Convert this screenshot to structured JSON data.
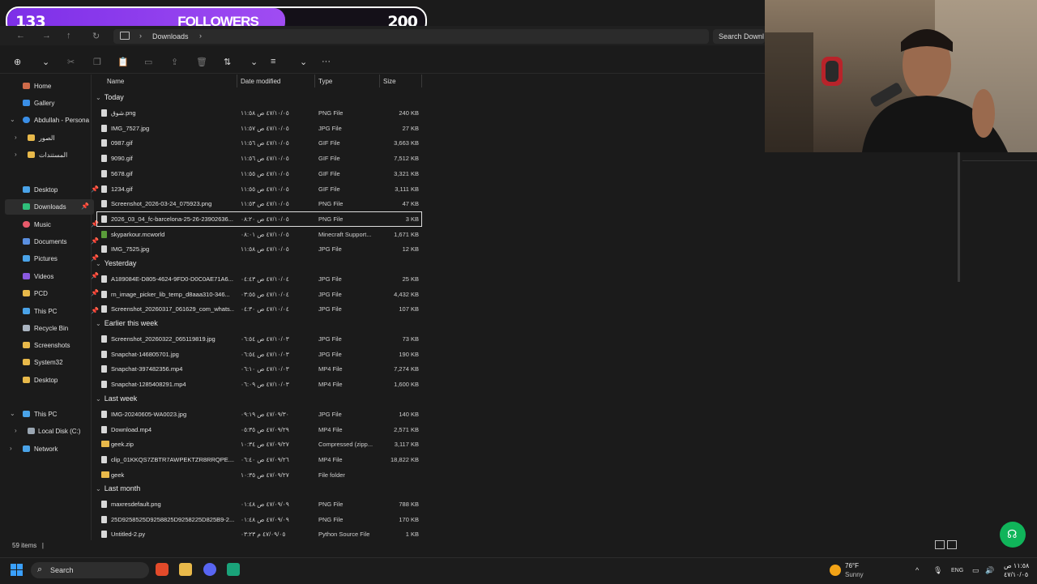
{
  "overlay": {
    "current": "133",
    "label": "FOLLOWERS",
    "goal": "200",
    "progress": 0.665
  },
  "nav": {
    "back": "←",
    "forward": "→",
    "up": "↑",
    "refresh": "↻",
    "sep": "›"
  },
  "breadcrumb": {
    "label": "Downloads"
  },
  "search": {
    "placeholder": "Search Downl"
  },
  "toolbar": {
    "new": "⊕",
    "new_chev": "⌄",
    "cut": "✂",
    "copy": "❐",
    "paste": "📋",
    "rename": "▭",
    "share": "⇪",
    "delete": "🗑",
    "sort": "⇅",
    "sort_chev": "⌄",
    "view": "≡",
    "view_chev": "⌄",
    "more": "···"
  },
  "sidebar": {
    "home": "Home",
    "gallery": "Gallery",
    "onedrive": "Abdullah - Persona",
    "pics_ar": "الصور",
    "docs_ar": "المستندات",
    "quick": [
      "Desktop",
      "Downloads",
      "Music",
      "Documents",
      "Pictures",
      "Videos",
      "PCD",
      "This PC",
      "Recycle Bin",
      "Screenshots",
      "System32",
      "Desktop"
    ],
    "this_pc": "This PC",
    "local_disk": "Local Disk (C:)",
    "network": "Network"
  },
  "columns": {
    "name": "Name",
    "date": "Date modified",
    "type": "Type",
    "size": "Size"
  },
  "groups": {
    "today": {
      "label": "Today",
      "files": [
        {
          "name": "شوق.png",
          "date": "٤٧/١٠/٠٥ ص ١١:٥٨",
          "type": "PNG File",
          "size": "240 KB"
        },
        {
          "name": "IMG_7527.jpg",
          "date": "٤٧/١٠/٠٥ ص ١١:٥٧",
          "type": "JPG File",
          "size": "27 KB"
        },
        {
          "name": "0987.gif",
          "date": "٤٧/١٠/٠٥ ص ١١:٥٦",
          "type": "GIF File",
          "size": "3,663 KB"
        },
        {
          "name": "9090.gif",
          "date": "٤٧/١٠/٠٥ ص ١١:٥٦",
          "type": "GIF File",
          "size": "7,512 KB"
        },
        {
          "name": "5678.gif",
          "date": "٤٧/١٠/٠٥ ص ١١:٥٥",
          "type": "GIF File",
          "size": "3,321 KB"
        },
        {
          "name": "1234.gif",
          "date": "٤٧/١٠/٠٥ ص ١١:٥٥",
          "type": "GIF File",
          "size": "3,111 KB"
        },
        {
          "name": "Screenshot_2026-03-24_075923.png",
          "date": "٤٧/١٠/٠٥ ص ١١:٥٣",
          "type": "PNG File",
          "size": "47 KB"
        },
        {
          "name": "2026_03_04_fc-barcelona-25-26-23902636...",
          "date": "٤٧/١٠/٠٥ ص ٠٨:٢٠",
          "type": "PNG File",
          "size": "3 KB"
        },
        {
          "name": "skyparkour.mcworld",
          "date": "٤٧/١٠/٠٥ ص ٠٨:٠١",
          "type": "Minecraft Support...",
          "size": "1,671 KB"
        },
        {
          "name": "IMG_7525.jpg",
          "date": "٤٧/١٠/٠٥ ص ١١:٥٨",
          "type": "JPG File",
          "size": "12 KB"
        }
      ]
    },
    "yesterday": {
      "label": "Yesterday",
      "files": [
        {
          "name": "A189084E-D805-4624-9FD0-D0C0AE71A6...",
          "date": "٤٧/١٠/٠٤ ص ٠٤:٤٣",
          "type": "JPG File",
          "size": "25 KB"
        },
        {
          "name": "rn_image_picker_lib_temp_d8aaa310-346...",
          "date": "٤٧/١٠/٠٤ ص ٠٣:٥٥",
          "type": "JPG File",
          "size": "4,432 KB"
        },
        {
          "name": "Screenshot_20260317_061629_com_whats...",
          "date": "٤٧/١٠/٠٤ ص ٠٤:٣٠",
          "type": "JPG File",
          "size": "107 KB"
        }
      ]
    },
    "earlier": {
      "label": "Earlier this week",
      "files": [
        {
          "name": "Screenshot_20260322_065119819.jpg",
          "date": "٤٧/١٠/٠٣ ص ٠٦:٥٤",
          "type": "JPG File",
          "size": "73 KB"
        },
        {
          "name": "Snapchat-146805701.jpg",
          "date": "٤٧/١٠/٠٣ ص ٠٦:٥٤",
          "type": "JPG File",
          "size": "190 KB"
        },
        {
          "name": "Snapchat-397482356.mp4",
          "date": "٤٧/١٠/٠٣ ص ٠٦:١٠",
          "type": "MP4 File",
          "size": "7,274 KB"
        },
        {
          "name": "Snapchat-1285408291.mp4",
          "date": "٤٧/١٠/٠٣ ص ٠٦:٠٩",
          "type": "MP4 File",
          "size": "1,600 KB"
        }
      ]
    },
    "lastweek": {
      "label": "Last week",
      "files": [
        {
          "name": "IMG-20240605-WA0023.jpg",
          "date": "٤٧/٠٩/٣٠ ص ٠٩:١٩",
          "type": "JPG File",
          "size": "140 KB"
        },
        {
          "name": "Download.mp4",
          "date": "٤٧/٠٩/٢٩ ص ٠٥:٣٥",
          "type": "MP4 File",
          "size": "2,571 KB"
        },
        {
          "name": "geek.zip",
          "date": "٤٧/٠٩/٢٧ ص ١٠:٣٤",
          "type": "Compressed (zipp...",
          "size": "3,117 KB"
        },
        {
          "name": "clip_01KKQS7ZBTR7AWPEKTZR8RRQPE....",
          "date": "٤٧/٠٩/٢٦ ص ٠٦:٤٠",
          "type": "MP4 File",
          "size": "18,822 KB"
        },
        {
          "name": "geek",
          "date": "٤٧/٠٩/٢٧ ص ١٠:٣٥",
          "type": "File folder",
          "size": ""
        }
      ]
    },
    "lastmonth": {
      "label": "Last month",
      "files": [
        {
          "name": "maxresdefault.png",
          "date": "٤٧/٠٩/٠٩ ص ٠١:٤٨",
          "type": "PNG File",
          "size": "788 KB"
        },
        {
          "name": "25D9258525D9258825D9258225D825B9-2...",
          "date": "٤٧/٠٩/٠٩ ص ٠١:٤٨",
          "type": "PNG File",
          "size": "170 KB"
        },
        {
          "name": "Untitled-2.py",
          "date": "٤٧/٠٩/٠٥ م ٠٣:٢٣",
          "type": "Python Source File",
          "size": "1 KB"
        }
      ]
    }
  },
  "status": {
    "count": "59 items",
    "sep": "|"
  },
  "taskbar": {
    "search": "Search",
    "search_icon": "⌕",
    "temp": "76°F",
    "condition": "Sunny",
    "chevron": "^",
    "lang": "ENG",
    "time": "١١:٥٨ ص",
    "date": "٤٧/١٠/٠٥"
  },
  "colors": {
    "accent": "#7d2fe8",
    "folder": "#e8b94a",
    "fab": "#10b45a"
  }
}
